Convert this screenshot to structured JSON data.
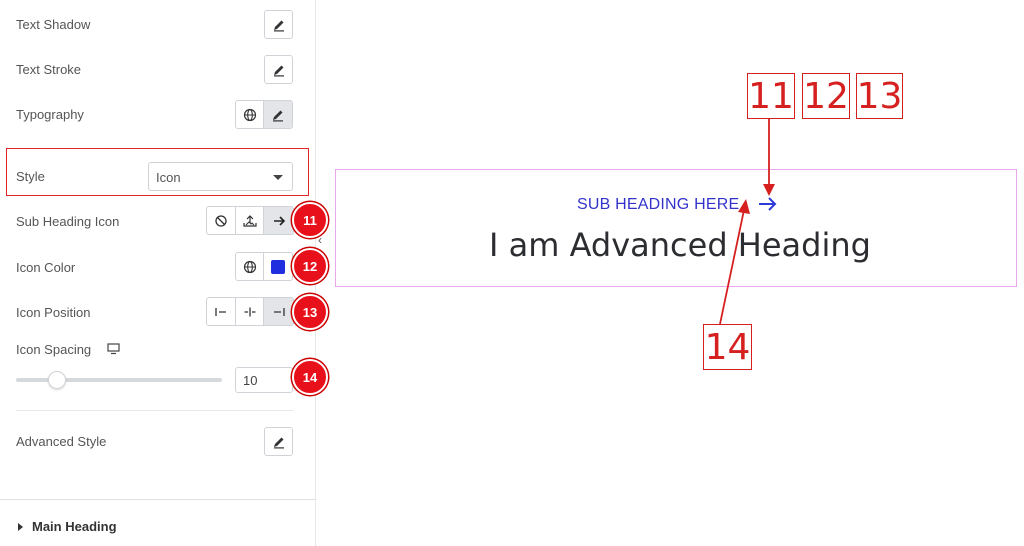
{
  "panel": {
    "text_shadow": "Text Shadow",
    "text_stroke": "Text Stroke",
    "typography": "Typography",
    "style_label": "Style",
    "style_value": "Icon",
    "sub_heading_icon": "Sub Heading Icon",
    "icon_color": "Icon Color",
    "icon_color_value": "#1f2fe0",
    "icon_position": "Icon Position",
    "icon_spacing": "Icon Spacing",
    "icon_spacing_value": "10",
    "icon_spacing_slider_fraction": 0.1,
    "advanced_style": "Advanced Style",
    "section_main_heading": "Main Heading"
  },
  "badges": {
    "b11": "11",
    "b12": "12",
    "b13": "13",
    "b14": "14"
  },
  "preview": {
    "sub_heading": "SUB HEADING HERE",
    "main_heading": "I am Advanced Heading"
  },
  "callouts": {
    "c11": "11",
    "c12": "12",
    "c13": "13",
    "c14": "14"
  },
  "colors": {
    "accent_red": "#e8111b",
    "sub_heading_blue": "#3333cc",
    "preview_border": "#e9a8ec"
  }
}
